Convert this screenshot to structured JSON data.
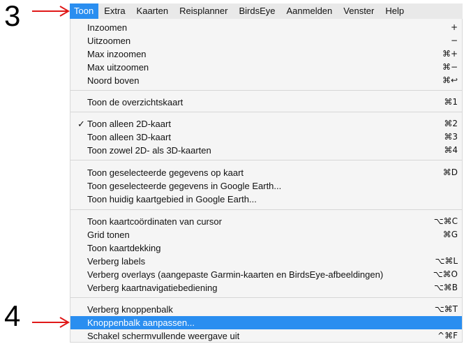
{
  "annotations": {
    "step3": "3",
    "step4": "4",
    "arrow_color": "#e01818"
  },
  "menubar": {
    "items": [
      "Toon",
      "Extra",
      "Kaarten",
      "Reisplanner",
      "BirdsEye",
      "Aanmelden",
      "Venster",
      "Help"
    ],
    "active": "Toon",
    "highlight_color": "#2a8ef0"
  },
  "menu": {
    "items": [
      {
        "label": "Inzoomen",
        "shortcut": "+"
      },
      {
        "label": "Uitzoomen",
        "shortcut": "−"
      },
      {
        "label": "Max inzoomen",
        "shortcut": "⌘+"
      },
      {
        "label": "Max uitzoomen",
        "shortcut": "⌘−"
      },
      {
        "label": "Noord boven",
        "shortcut": "⌘↩"
      },
      {
        "label": "Toon de overzichtskaart",
        "shortcut": "⌘1"
      },
      {
        "label": "Toon alleen 2D-kaart",
        "shortcut": "⌘2",
        "check": "✓"
      },
      {
        "label": "Toon alleen 3D-kaart",
        "shortcut": "⌘3"
      },
      {
        "label": "Toon zowel 2D- als 3D-kaarten",
        "shortcut": "⌘4"
      },
      {
        "label": "Toon geselecteerde gegevens op kaart",
        "shortcut": "⌘D"
      },
      {
        "label": "Toon geselecteerde gegevens in Google Earth...",
        "shortcut": ""
      },
      {
        "label": "Toon huidig kaartgebied in Google Earth...",
        "shortcut": ""
      },
      {
        "label": "Toon kaartcoördinaten van cursor",
        "shortcut": "⌥⌘C"
      },
      {
        "label": "Grid tonen",
        "shortcut": "⌘G"
      },
      {
        "label": "Toon kaartdekking",
        "shortcut": ""
      },
      {
        "label": "Verberg labels",
        "shortcut": "⌥⌘L"
      },
      {
        "label": "Verberg overlays (aangepaste Garmin-kaarten en BirdsEye-afbeeldingen)",
        "shortcut": "⌥⌘O"
      },
      {
        "label": "Verberg kaartnavigatiebediening",
        "shortcut": "⌥⌘B"
      },
      {
        "label": "Verberg knoppenbalk",
        "shortcut": "⌥⌘T"
      },
      {
        "label": "Knoppenbalk aanpassen...",
        "shortcut": "",
        "highlighted": true
      },
      {
        "label": "Schakel schermvullende weergave uit",
        "shortcut": "^⌘F"
      }
    ]
  }
}
